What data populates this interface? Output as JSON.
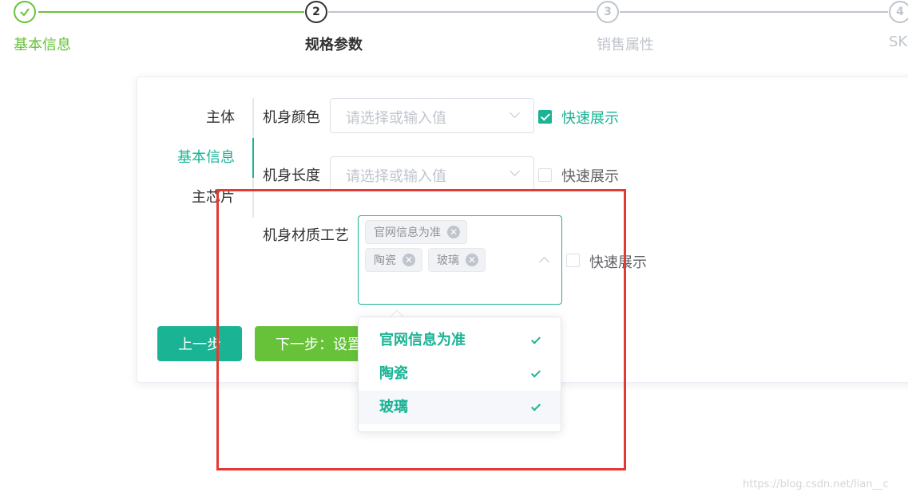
{
  "steps": [
    {
      "number": "",
      "title": "基本信息",
      "status": "done"
    },
    {
      "number": "2",
      "title": "规格参数",
      "status": "active"
    },
    {
      "number": "3",
      "title": "销售属性",
      "status": "wait"
    },
    {
      "number": "4",
      "title": "SK",
      "status": "wait"
    }
  ],
  "tabs": [
    {
      "label": "主体",
      "active": false
    },
    {
      "label": "基本信息",
      "active": true
    },
    {
      "label": "主芯片",
      "active": false
    }
  ],
  "fields": [
    {
      "label": "机身颜色",
      "placeholder": "请选择或输入值",
      "quick_show_label": "快速展示",
      "quick_show_checked": true
    },
    {
      "label": "机身长度",
      "placeholder": "请选择或输入值",
      "quick_show_label": "快速展示",
      "quick_show_checked": false
    },
    {
      "label": "机身材质工艺",
      "tags": [
        "官网信息为准",
        "陶瓷",
        "玻璃"
      ],
      "tag_close_icon": "✕",
      "quick_show_label": "快速展示",
      "quick_show_checked": false
    }
  ],
  "buttons": {
    "prev_label": "上一步",
    "next_label": "下一步：设置"
  },
  "dropdown": {
    "options": [
      {
        "label": "官网信息为准",
        "selected": true
      },
      {
        "label": "陶瓷",
        "selected": true
      },
      {
        "label": "玻璃",
        "selected": true
      }
    ]
  },
  "watermark": "https://blog.csdn.net/lian__c",
  "colors": {
    "primary": "#1ab394",
    "success": "#67c23a",
    "annotation": "#e53935"
  }
}
